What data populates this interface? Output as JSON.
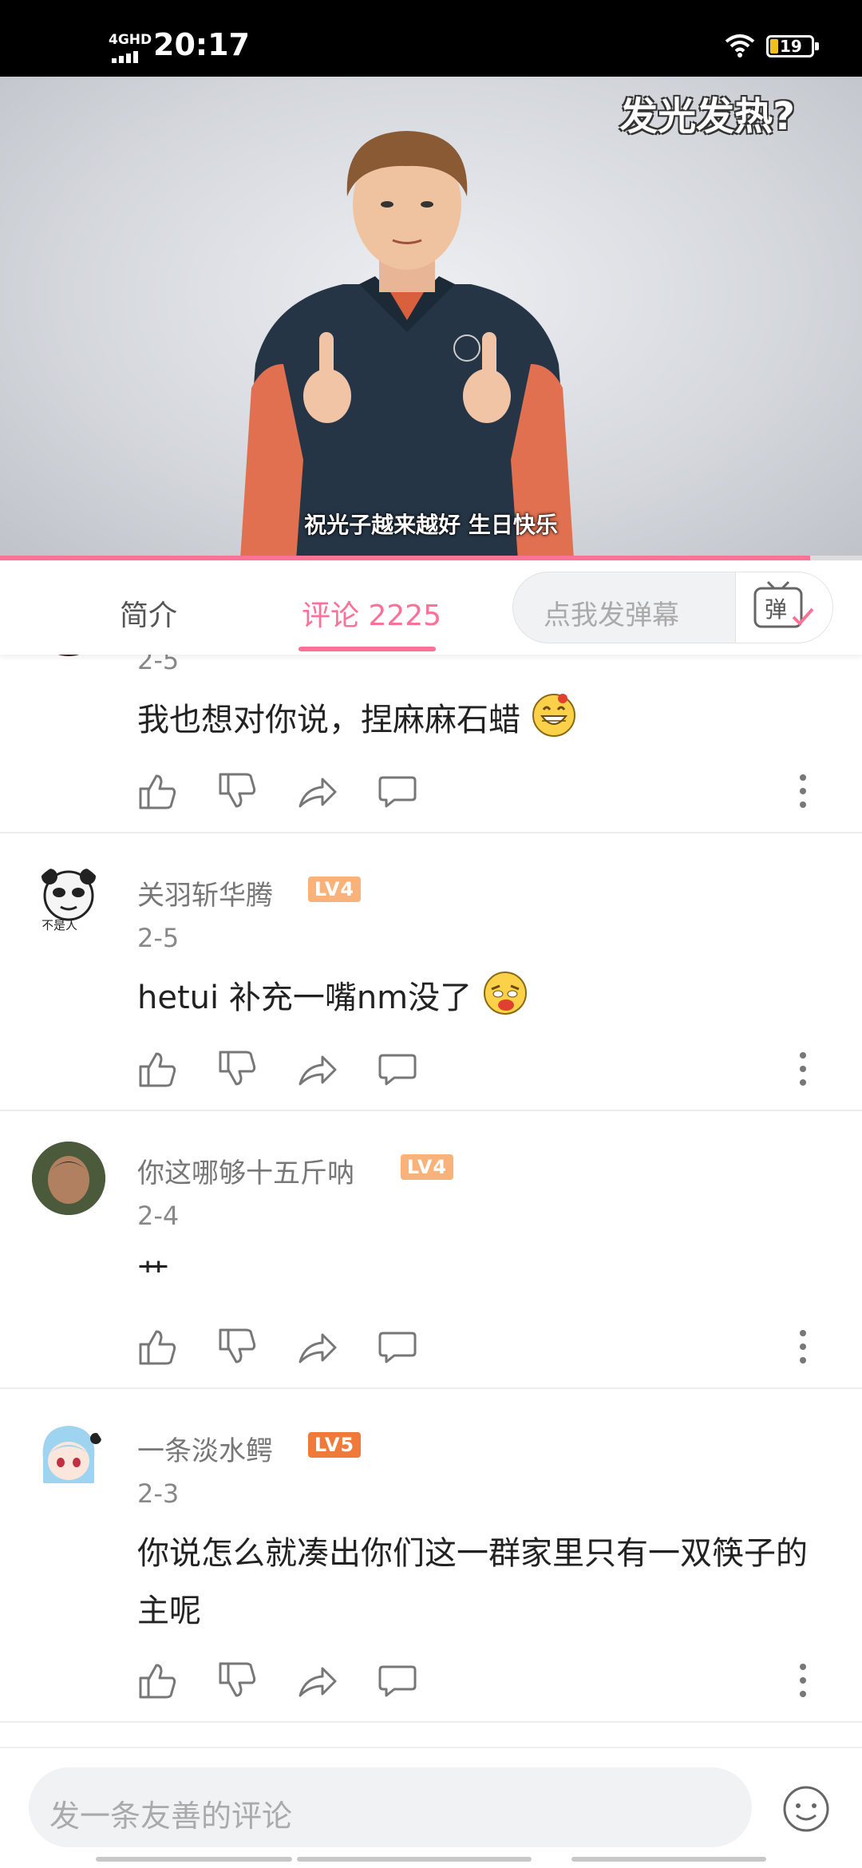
{
  "status_bar": {
    "network": "4GHD",
    "time": "20:17",
    "battery": "19"
  },
  "video": {
    "title_overlay": "发光发热?",
    "subtitle": "祝光子越来越好 生日快乐",
    "progress_fraction": 0.94
  },
  "tabs": {
    "intro": "简介",
    "comments": "评论 2225",
    "danmaku_placeholder": "点我发弹幕",
    "danmaku_button": "弹"
  },
  "comments": [
    {
      "user": "",
      "level": "",
      "date": "2-5",
      "text": "我也想对你说，捏麻麻石蜡",
      "emoji": "grin"
    },
    {
      "user": "关羽斩华腾",
      "level": "LV4",
      "date": "2-5",
      "text": "hetui 补充一嘴nm没了",
      "emoji": "spicy"
    },
    {
      "user": "你这哪够十五斤呐",
      "level": "LV4",
      "date": "2-4",
      "text": "艹",
      "emoji": ""
    },
    {
      "user": "一条淡水鳄",
      "level": "LV5",
      "date": "2-3",
      "text": "你说怎么就凑出你们这一群家里只有一双筷子的主呢",
      "emoji": ""
    }
  ],
  "avatar_captions": {
    "panda": "不是人"
  },
  "bottom": {
    "placeholder": "发一条友善的评论"
  },
  "colors": {
    "accent": "#fb7299",
    "lv4": "#f8b27a",
    "lv5": "#f07a3a"
  },
  "icons": [
    "like-icon",
    "dislike-icon",
    "share-icon",
    "reply-icon",
    "more-icon",
    "emoji-face-icon"
  ]
}
